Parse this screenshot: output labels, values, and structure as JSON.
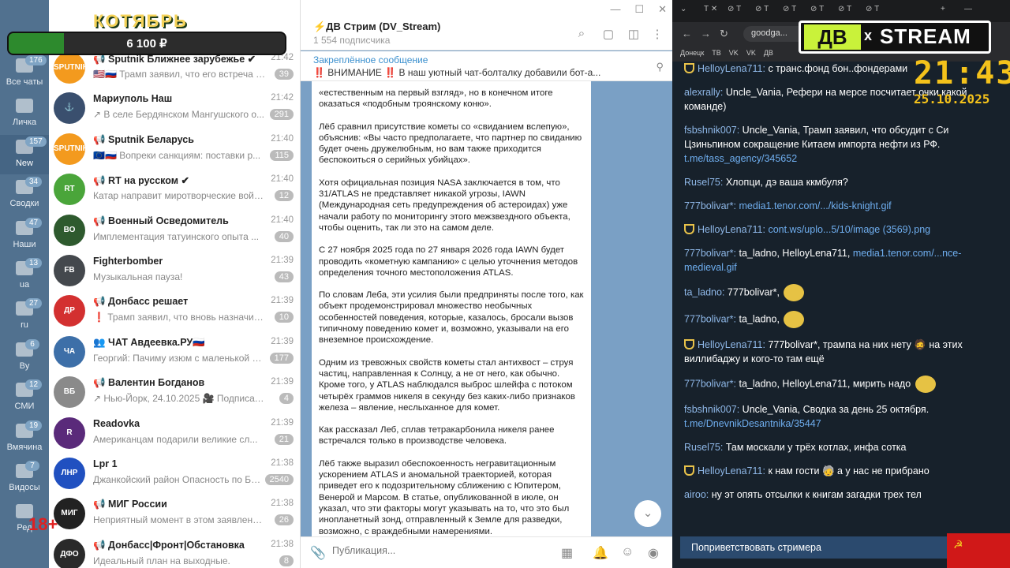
{
  "overlay": {
    "month": "КОТЯБРЬ",
    "balance": "6 100 ₽",
    "balance_fill": 0.2,
    "age": "18+"
  },
  "folders": [
    {
      "label": "Все чаты",
      "badge": "176"
    },
    {
      "label": "Личка",
      "badge": ""
    },
    {
      "label": "New",
      "badge": "157"
    },
    {
      "label": "Сводки",
      "badge": "34"
    },
    {
      "label": "Наши",
      "badge": "47"
    },
    {
      "label": "ua",
      "badge": "13"
    },
    {
      "label": "ru",
      "badge": "27"
    },
    {
      "label": "By",
      "badge": "6"
    },
    {
      "label": "СМИ",
      "badge": "12"
    },
    {
      "label": "Вмячина",
      "badge": "19"
    },
    {
      "label": "Видосы",
      "badge": "7"
    },
    {
      "label": "Ред",
      "badge": ""
    }
  ],
  "chats": [
    {
      "name": "📢 Sputnik Ближнее зарубежье ✔",
      "time": "21:42",
      "preview": "🇺🇸🇷🇺 Трамп заявил, что его встреча с Пу...",
      "unread": "39",
      "avatar": "SPUTNIK LIVE",
      "color": "#f39a1e"
    },
    {
      "name": "Мариуполь Наш",
      "time": "21:42",
      "preview": "↗ В селе Бердянском Мангушского о...",
      "unread": "291",
      "avatar": "⚓",
      "color": "#3a4f6e"
    },
    {
      "name": "📢 Sputnik Беларусь",
      "time": "21:40",
      "preview": "🇪🇺🇷🇺 Вопреки санкциям: поставки р...",
      "unread": "115",
      "avatar": "SPUTNIK BY",
      "color": "#f39a1e"
    },
    {
      "name": "📢 RT на русском ✔",
      "time": "21:40",
      "preview": "Катар направит миротворческие войск...",
      "unread": "12",
      "avatar": "RT",
      "color": "#4aa53a"
    },
    {
      "name": "📢 Военный Осведомитель",
      "time": "21:40",
      "preview": "Имплементация татуинского опыта ...",
      "unread": "40",
      "avatar": "ВО",
      "color": "#2e5a2e"
    },
    {
      "name": "Fighterbomber",
      "time": "21:39",
      "preview": "Музыкальная пауза!",
      "unread": "43",
      "avatar": "FB",
      "color": "#44484d"
    },
    {
      "name": "📢 Донбасс решает",
      "time": "21:39",
      "preview": "❗ Трамп заявил, что вновь назначит встр...",
      "unread": "10",
      "avatar": "ДР",
      "color": "#d33030"
    },
    {
      "name": "👥 ЧАТ Авдеевка.РУ🇷🇺",
      "time": "21:39",
      "preview": "Георгий: Пачиму изюм с маленькой букв...",
      "unread": "177",
      "avatar": "ЧА",
      "color": "#3d6fa8"
    },
    {
      "name": "📢 Валентин Богданов",
      "time": "21:39",
      "preview": "↗ Нью-Йорк, 24.10.2025 🎥 Подписать...",
      "unread": "4",
      "avatar": "ВБ",
      "color": "#8a8a8a"
    },
    {
      "name": "Readovka",
      "time": "21:39",
      "preview": "Американцам подарили великие сл...",
      "unread": "21",
      "avatar": "R",
      "color": "#5a2a7a"
    },
    {
      "name": "Lpr 1",
      "time": "21:38",
      "preview": "Джанкойский район  Опасность по БПЛ...",
      "unread": "2540",
      "avatar": "ЛНР",
      "color": "#2050c0"
    },
    {
      "name": "📢 МИГ России",
      "time": "21:38",
      "preview": "Неприятный момент в этом заявлении ам...",
      "unread": "26",
      "avatar": "МИГ",
      "color": "#222"
    },
    {
      "name": "📢 Донбасс|Фронт|Обстановка",
      "time": "21:38",
      "preview": "Идеальный план на выходные.",
      "unread": "8",
      "avatar": "ДФО",
      "color": "#2a2a2a"
    }
  ],
  "channel": {
    "title": "⚡ДВ Стрим (DV_Stream)",
    "subscribers": "1 554 подписчика",
    "pinned_label": "Закреплённое сообщение",
    "pinned_text": "‼️ ВНИМАНИЕ ‼️ В наш уютный чат-болталку добавили бот-а...",
    "paragraphs": [
      "«естественным на первый взгляд», но в конечном итоге оказаться «подобным троянскому коню».",
      "Лёб сравнил присутствие кометы со «свиданием вслепую», объяснив: «Вы часто предполагаете, что партнер по свиданию будет очень дружелюбным, но вам также приходится беспокоиться о серийных убийцах».",
      "Хотя официальная позиция NASA заключается в том, что 31/ATLAS не представляет никакой угрозы, IAWN (Международная сеть предупреждения об астероидах) уже начали работу по мониторингу этого межзвездного объекта, чтобы оценить, так ли это на самом деле.",
      "С 27 ноября 2025 года по 27 января 2026 года IAWN будет проводить «кометную кампанию» с целью уточнения методов определения точного местоположения ATLAS.",
      "По словам Леба, эти усилия были предприняты после того, как объект продемонстрировал множество необычных особенностей поведения, которые, казалось, бросали вызов типичному поведению комет и, возможно, указывали на его внеземное происхождение.",
      "Одним из тревожных свойств кометы стал антихвост – струя частиц, направленная к Солнцу, а не от него, как обычно. Кроме того, у ATLAS наблюдался выброс шлейфа с потоком четырёх граммов никеля в секунду без каких-либо признаков железа – явление, неслыханное для комет.",
      "Как рассказал Леб, сплав тетракарбонила никеля ранее встречался только в производстве человека.",
      "Лёб также выразил обеспокоенность негравитационным ускорением ATLAS и аномальной траекторией, которая приведет его к подозрительному сближению с Юпитером, Венерой и Марсом. В статье, опубликованной в июле, он указал, что эти факторы могут указывать на то, что это был инопланетный зонд, отправленный к Земле для разведки, возможно, с враждебными намерениями."
    ],
    "compose_placeholder": "Публикация..."
  },
  "browser": {
    "url": "goodga...",
    "bookmarks": [
      "Донецк",
      "ТВ",
      "VK",
      "VK",
      "ДВ"
    ]
  },
  "stream": {
    "logo_left": "ДВ",
    "logo_x": "x",
    "logo_right": "STREAM",
    "clock": "21:43",
    "date": "25.10.2025",
    "greet": "Поприветствовать стримера",
    "messages": [
      {
        "user": "HelloyLena711:",
        "mod": true,
        "text": "с транс.фонд бон..фондерами"
      },
      {
        "user": "alexrally:",
        "text": "Uncle_Vania, Рефери на мерсе посчитает очки какой команде)"
      },
      {
        "user": "fsbshnik007:",
        "text": "Uncle_Vania, Трамп заявил, что обсудит с Си Цзиньпином сокращение Китаем импорта нефти из РФ.",
        "link": "t.me/tass_agency/345652"
      },
      {
        "user": "Rusel75:",
        "text": "Хлопци, дэ ваша ккмбуля?"
      },
      {
        "user": "777bolivar*:",
        "link": "media1.tenor.com/.../kids-knight.gif"
      },
      {
        "user": "HelloyLena711:",
        "mod": true,
        "link": "cont.ws/uplo...5/10/image (3569).png"
      },
      {
        "user": "777bolivar*:",
        "text": "ta_ladno, HelloyLena711,",
        "link": "media1.tenor.com/...nce-medieval.gif"
      },
      {
        "user": "ta_ladno:",
        "text": "777bolivar*,",
        "emote": true
      },
      {
        "user": "777bolivar*:",
        "text": "ta_ladno,",
        "emote": true
      },
      {
        "user": "HelloyLena711:",
        "mod": true,
        "text": "777bolivar*, трампа на них нету 🧔 на этих виллибаджу и кого-то там ещё"
      },
      {
        "user": "777bolivar*:",
        "text": "ta_ladno, HelloyLena711, мирить надо",
        "emote": true
      },
      {
        "user": "fsbshnik007:",
        "text": "Uncle_Vania, Сводка за день 25 октября.",
        "link": "t.me/DnevnikDesantnika/35447"
      },
      {
        "user": "Rusel75:",
        "text": "Там москали у трёх котлах, инфа сотка"
      },
      {
        "user": "HelloyLena711:",
        "mod": true,
        "text": "к нам гости 🧓 а у нас не прибрано"
      },
      {
        "user": "airoo:",
        "text": "ну эт опять отсылки к книгам загадки трех тел"
      }
    ]
  }
}
